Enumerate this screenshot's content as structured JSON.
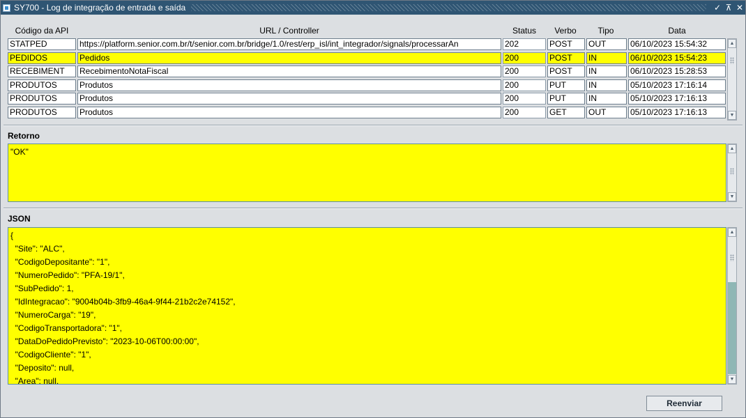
{
  "window": {
    "title": "SY700 - Log de integração de entrada e saída",
    "controls": [
      "✓",
      "⊼",
      "✕"
    ]
  },
  "grid": {
    "headers": [
      "Código da API",
      "URL / Controller",
      "Status",
      "Verbo",
      "Tipo",
      "Data"
    ],
    "rows": [
      {
        "api": "STATPED",
        "url": "https://platform.senior.com.br/t/senior.com.br/bridge/1.0/rest/erp_isl/int_integrador/signals/processarAn",
        "status": "202",
        "verbo": "POST",
        "tipo": "OUT",
        "data": "06/10/2023 15:54:32"
      },
      {
        "api": "PEDIDOS",
        "url": "Pedidos",
        "status": "200",
        "verbo": "POST",
        "tipo": "IN",
        "data": "06/10/2023 15:54:23"
      },
      {
        "api": "RECEBIMENT",
        "url": "RecebimentoNotaFiscal",
        "status": "200",
        "verbo": "POST",
        "tipo": "IN",
        "data": "06/10/2023 15:28:53"
      },
      {
        "api": "PRODUTOS",
        "url": "Produtos",
        "status": "200",
        "verbo": "PUT",
        "tipo": "IN",
        "data": "05/10/2023 17:16:14"
      },
      {
        "api": "PRODUTOS",
        "url": "Produtos",
        "status": "200",
        "verbo": "PUT",
        "tipo": "IN",
        "data": "05/10/2023 17:16:13"
      },
      {
        "api": "PRODUTOS",
        "url": "Produtos",
        "status": "200",
        "verbo": "GET",
        "tipo": "OUT",
        "data": "05/10/2023 17:16:13"
      }
    ],
    "selected_row": 1
  },
  "retorno": {
    "label": "Retorno",
    "value": "\"OK\""
  },
  "json": {
    "label": "JSON",
    "lines": [
      "{",
      "  \"Site\": \"ALC\",",
      "  \"CodigoDepositante\": \"1\",",
      "  \"NumeroPedido\": \"PFA-19/1\",",
      "  \"SubPedido\": 1,",
      "  \"IdIntegracao\": \"9004b04b-3fb9-46a4-9f44-21b2c2e74152\",",
      "  \"NumeroCarga\": \"19\",",
      "  \"CodigoTransportadora\": \"1\",",
      "  \"DataDoPedidoPrevisto\": \"2023-10-06T00:00:00\",",
      "  \"CodigoCliente\": \"1\",",
      "  \"Deposito\": null,",
      "  \"Area\": null,"
    ]
  },
  "buttons": {
    "reenviar": "Reenviar"
  },
  "colors": {
    "selection": "#ffff00",
    "titlebar": "#2f5573",
    "scroll_thumb": "#8fb7b5"
  }
}
